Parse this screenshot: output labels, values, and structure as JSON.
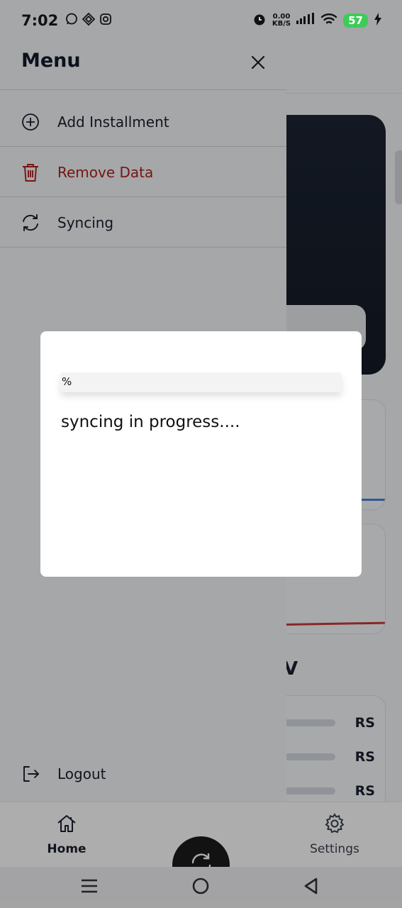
{
  "status_bar": {
    "time": "7:02",
    "net_speed_value": "0.00",
    "net_speed_unit": "KB/S",
    "battery": "57",
    "icons": [
      "whatsapp-icon",
      "app-icon",
      "instagram-icon",
      "alarm-icon",
      "signal-icon",
      "wifi-icon",
      "charging-icon"
    ]
  },
  "drawer": {
    "title": "Menu",
    "items": [
      {
        "label": "Add Installment",
        "icon": "plus-circle-icon"
      },
      {
        "label": "Remove Data",
        "icon": "trash-icon",
        "color": "#b01f1f"
      },
      {
        "label": "Syncing",
        "icon": "sync-icon"
      }
    ],
    "logout_label": "Logout"
  },
  "background": {
    "section_letter": "V",
    "rs_labels": [
      "RS",
      "RS",
      "RS"
    ],
    "dark_card_color": "#1c2433"
  },
  "bottom_nav": {
    "home_label": "Home",
    "settings_label": "Settings"
  },
  "dialog": {
    "progress_percent_text": "%",
    "progress_fraction": 0,
    "message": "syncing in progress...."
  }
}
